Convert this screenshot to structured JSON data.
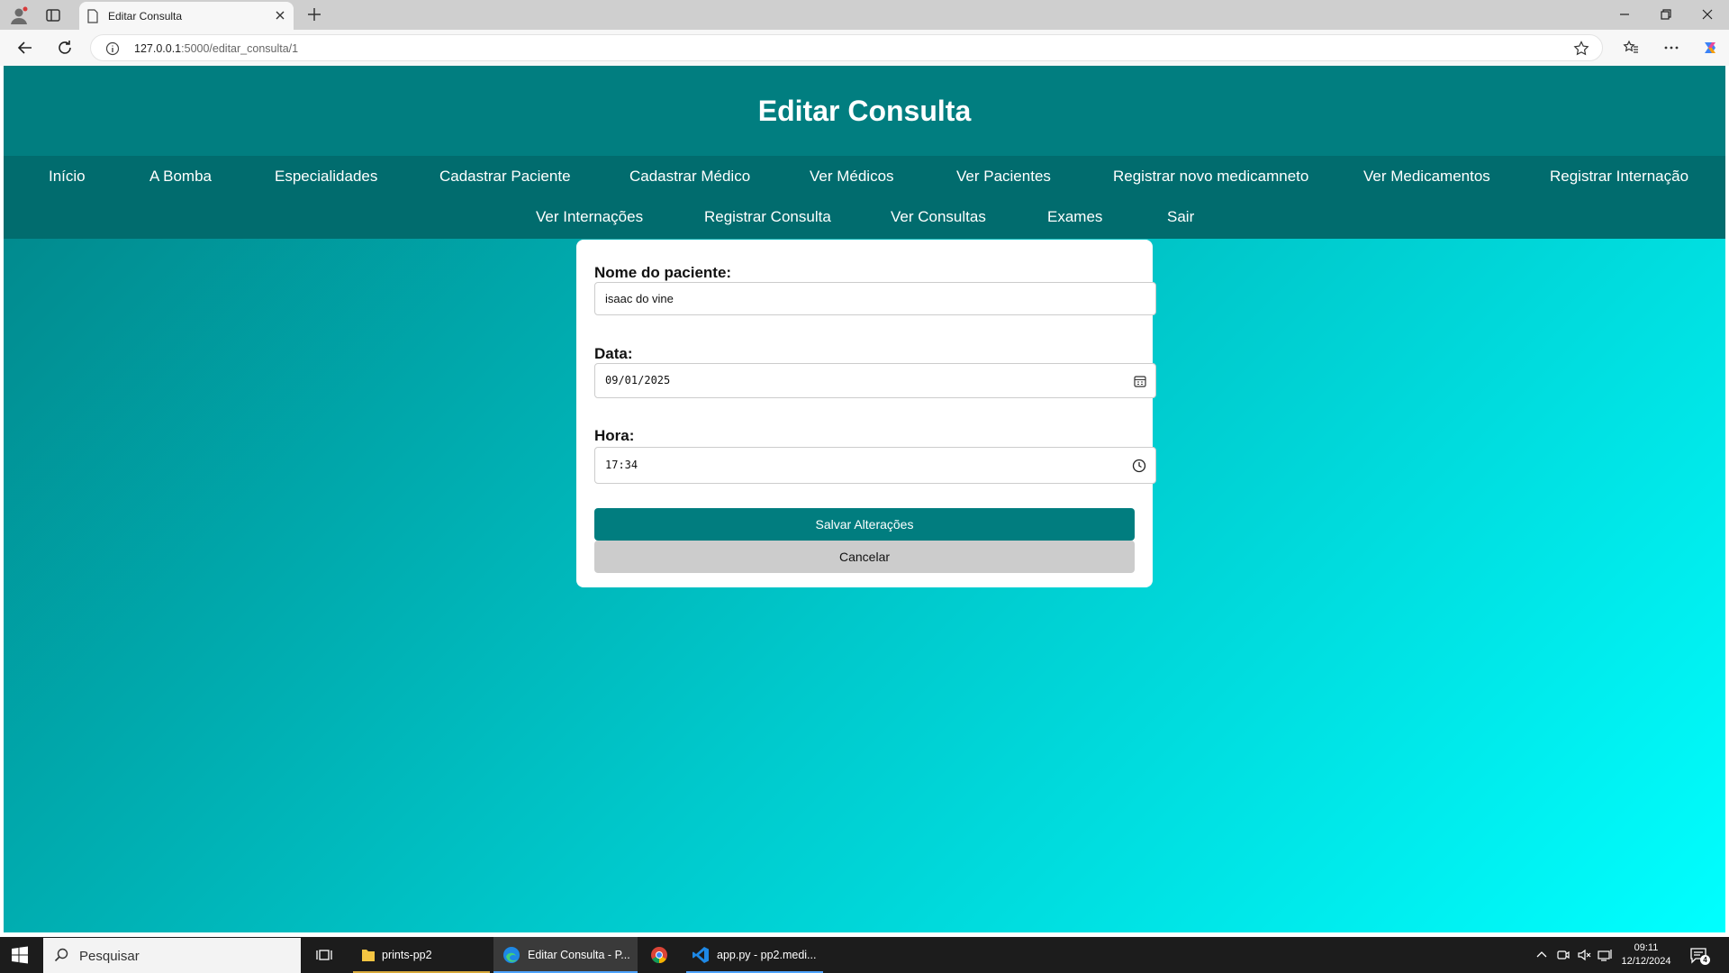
{
  "browser": {
    "tab_title": "Editar Consulta",
    "url_host": "127.0.0.1",
    "url_path": ":5000/editar_consulta/1"
  },
  "page": {
    "title": "Editar Consulta",
    "nav_row1": [
      "Início",
      "A Bomba",
      "Especialidades",
      "Cadastrar Paciente",
      "Cadastrar Médico",
      "Ver Médicos",
      "Ver Pacientes",
      "Registrar novo medicamneto",
      "Ver Medicamentos",
      "Registrar Internação"
    ],
    "nav_row2": [
      "Ver Internações",
      "Registrar Consulta",
      "Ver Consultas",
      "Exames",
      "Sair"
    ]
  },
  "form": {
    "patient_label": "Nome do paciente:",
    "patient_value": "isaac do vine",
    "date_label": "Data:",
    "date_value": "09/01/2025",
    "time_label": "Hora:",
    "time_value": "17:34",
    "save_label": "Salvar Alterações",
    "cancel_label": "Cancelar"
  },
  "taskbar": {
    "search_placeholder": "Pesquisar",
    "items": [
      "prints-pp2",
      "Editar Consulta - P...",
      "app.py - pp2.medi..."
    ],
    "time": "09:11",
    "date": "12/12/2024",
    "notif_count": "4"
  },
  "colors": {
    "header": "#017e80",
    "nav": "#016c6e",
    "save_button": "#017d7f",
    "cancel_button": "#cccccc"
  }
}
